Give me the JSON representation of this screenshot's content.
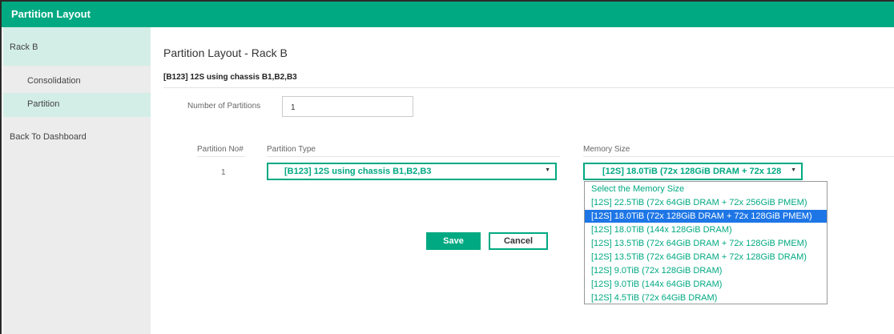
{
  "window": {
    "title": "Partition Layout"
  },
  "sidebar": {
    "items": [
      {
        "label": "Rack B"
      },
      {
        "label": "Consolidation"
      },
      {
        "label": "Partition"
      },
      {
        "label": "Back To Dashboard"
      }
    ]
  },
  "main": {
    "title": "Partition Layout - Rack B",
    "subtitle": "[B123] 12S using chassis B1,B2,B3",
    "num_partitions_label": "Number of Partitions",
    "num_partitions_value": "1",
    "columns": {
      "partition_no": "Partition No#",
      "partition_type": "Partition Type",
      "memory_size": "Memory Size"
    },
    "row": {
      "partition_no": "1",
      "partition_type": "[B123] 12S using chassis B1,B2,B3",
      "memory_size": "[12S] 18.0TiB (72x 128GiB DRAM + 72x 128"
    },
    "memory_options": [
      "Select the Memory Size",
      "[12S] 22.5TiB (72x 64GiB DRAM + 72x 256GiB PMEM)",
      "[12S] 18.0TiB (72x 128GiB DRAM + 72x 128GiB PMEM)",
      "[12S] 18.0TiB (144x 128GiB DRAM)",
      "[12S] 13.5TiB (72x 64GiB DRAM + 72x 128GiB PMEM)",
      "[12S] 13.5TiB (72x 64GiB DRAM + 72x 128GiB DRAM)",
      "[12S] 9.0TiB (72x 128GiB DRAM)",
      "[12S] 9.0TiB (144x 64GiB DRAM)",
      "[12S] 4.5TiB (72x 64GiB DRAM)"
    ],
    "selected_option_index": 2,
    "save_label": "Save",
    "cancel_label": "Cancel"
  },
  "colors": {
    "accent": "#01a982",
    "selection": "#1e76e6",
    "sidebar_active": "#d3eee7"
  }
}
